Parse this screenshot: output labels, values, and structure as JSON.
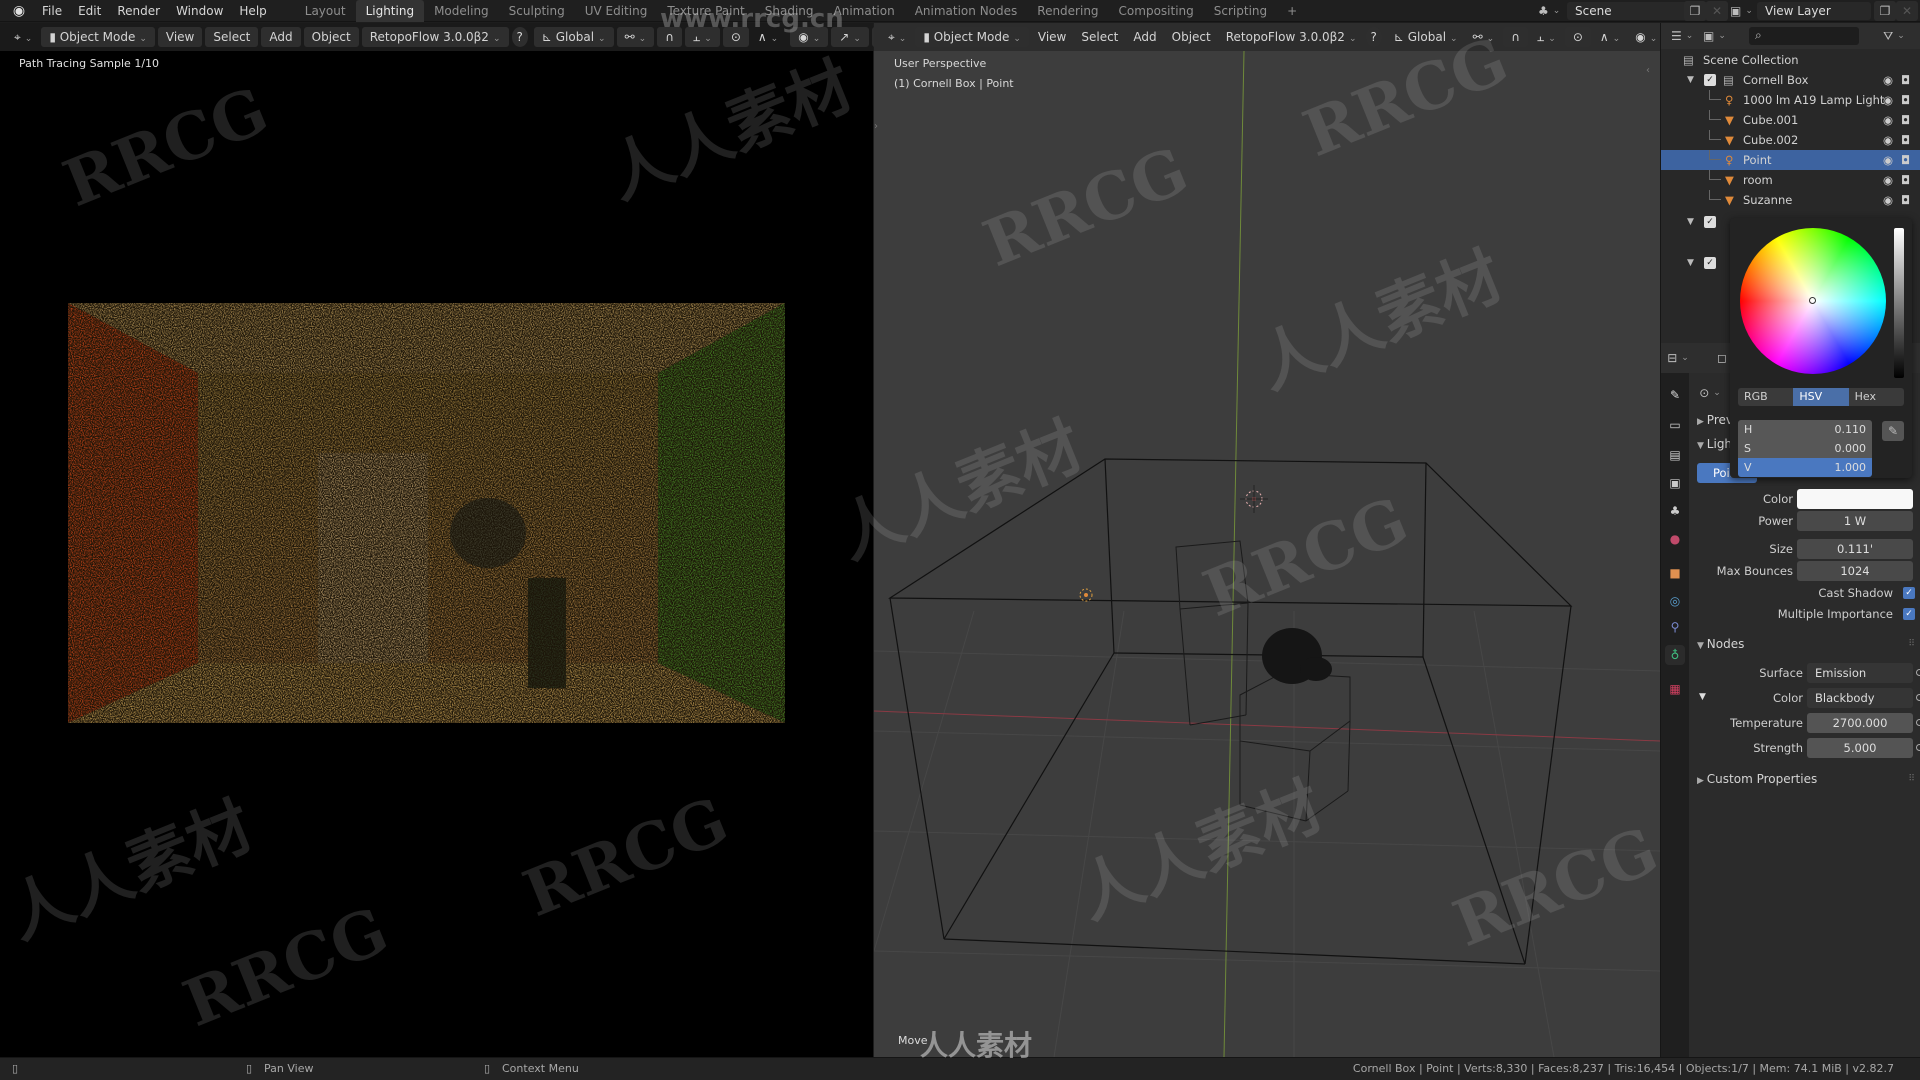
{
  "topbar": {
    "menus": [
      "File",
      "Edit",
      "Render",
      "Window",
      "Help"
    ],
    "workspaces": [
      "Layout",
      "Lighting",
      "Modeling",
      "Sculpting",
      "UV Editing",
      "Texture Paint",
      "Shading",
      "Animation",
      "Animation Nodes",
      "Rendering",
      "Compositing",
      "Scripting"
    ],
    "active_workspace": "Lighting",
    "add_tab": "+",
    "scene_label": "Scene",
    "view_layer_label": "View Layer"
  },
  "left_header": {
    "mode": "Object Mode",
    "menus": [
      "View",
      "Select",
      "Add",
      "Object"
    ],
    "addon": "RetopoFlow 3.0.0β2",
    "help": "?",
    "orientation": "Global"
  },
  "right_header": {
    "mode": "Object Mode",
    "menus": [
      "View",
      "Select",
      "Add",
      "Object"
    ],
    "addon": "RetopoFlow 3.0.0β2",
    "help": "?",
    "orientation": "Global"
  },
  "render_view": {
    "overlay_text": "Path Tracing Sample 1/10"
  },
  "viewport": {
    "perspective": "User Perspective",
    "context": "(1) Cornell Box | Point",
    "move_hint": "Move"
  },
  "outliner": {
    "root": "Scene Collection",
    "collection": "Cornell Box",
    "items": [
      {
        "name": "1000 lm A19 Lamp Light",
        "type": "light",
        "selected": false
      },
      {
        "name": "Cube.001",
        "type": "mesh",
        "selected": false
      },
      {
        "name": "Cube.002",
        "type": "mesh",
        "selected": false
      },
      {
        "name": "Point",
        "type": "light",
        "selected": true
      },
      {
        "name": "room",
        "type": "mesh",
        "selected": false
      },
      {
        "name": "Suzanne",
        "type": "mesh",
        "selected": false
      }
    ]
  },
  "color_picker": {
    "modes": [
      "RGB",
      "HSV",
      "Hex"
    ],
    "active_mode": "HSV",
    "h_label": "H",
    "h": "0.110",
    "s_label": "S",
    "s": "0.000",
    "v_label": "V",
    "v": "1.000"
  },
  "properties": {
    "preview_label": "Preview",
    "light_label": "Light",
    "light_type": "Point",
    "color_label": "Color",
    "color_value": "#f8f8f8",
    "power_label": "Power",
    "power": "1 W",
    "size_label": "Size",
    "size": "0.111'",
    "max_bounces_label": "Max Bounces",
    "max_bounces": "1024",
    "cast_shadow_label": "Cast Shadow",
    "cast_shadow": true,
    "mis_label": "Multiple Importance",
    "mis": true,
    "nodes_label": "Nodes",
    "surface_label": "Surface",
    "surface": "Emission",
    "node_color_label": "Color",
    "node_color": "Blackbody",
    "temperature_label": "Temperature",
    "temperature": "2700.000",
    "strength_label": "Strength",
    "strength": "5.000",
    "custom_props_label": "Custom Properties"
  },
  "statusbar": {
    "left_hint": "",
    "pan_view": "Pan View",
    "context_menu": "Context Menu",
    "stats": "Cornell Box | Point | Verts:8,330 | Faces:8,237 | Tris:16,454 | Objects:1/7 | Mem: 74.1 MiB | v2.82.7"
  },
  "watermarks": [
    "RRCG",
    "人人素材",
    "www.rrcg.cn"
  ],
  "colors": {
    "accent": "#4a78c0",
    "selection": "#3d63a0",
    "light_icon": "#e08a3a",
    "mesh_icon": "#e08a3a"
  }
}
